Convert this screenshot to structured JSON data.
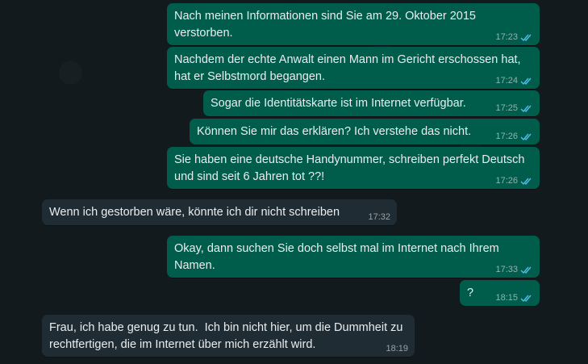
{
  "colors": {
    "background": "#121a1e",
    "outgoing_bubble": "#005c4b",
    "incoming_bubble": "#202c33",
    "read_ticks": "#53bdeb"
  },
  "messages": [
    {
      "direction": "outgoing",
      "text": "Nach meinen Informationen sind Sie am 29. Oktober 2015\nverstorben.",
      "time": "17:23",
      "status": "read"
    },
    {
      "direction": "outgoing",
      "text": "Nachdem der echte Anwalt einen Mann im Gericht erschossen hat,\nhat er Selbstmord begangen.",
      "time": "17:24",
      "status": "read"
    },
    {
      "direction": "outgoing",
      "text": "Sogar die Identitätskarte ist im Internet verfügbar.",
      "time": "17:25",
      "status": "read"
    },
    {
      "direction": "outgoing",
      "text": "Können Sie mir das erklären? Ich verstehe das nicht.",
      "time": "17:26",
      "status": "read"
    },
    {
      "direction": "outgoing",
      "text": "Sie haben eine deutsche Handynummer, schreiben perfekt Deutsch\nund sind seit 6 Jahren tot ??!",
      "time": "17:26",
      "status": "read"
    },
    {
      "direction": "incoming",
      "text": "Wenn ich gestorben wäre, könnte ich dir nicht schreiben",
      "time": "17:32"
    },
    {
      "direction": "outgoing",
      "text": "Okay, dann suchen Sie doch selbst mal im Internet nach Ihrem\nNamen.",
      "time": "17:33",
      "status": "read"
    },
    {
      "direction": "outgoing",
      "text": "?",
      "time": "18:15",
      "status": "read"
    },
    {
      "direction": "incoming",
      "text": "Frau, ich habe genug zu tun.  Ich bin nicht hier, um die Dummheit zu\nrechtfertigen, die im Internet über mich erzählt wird.",
      "time": "18:19"
    }
  ]
}
